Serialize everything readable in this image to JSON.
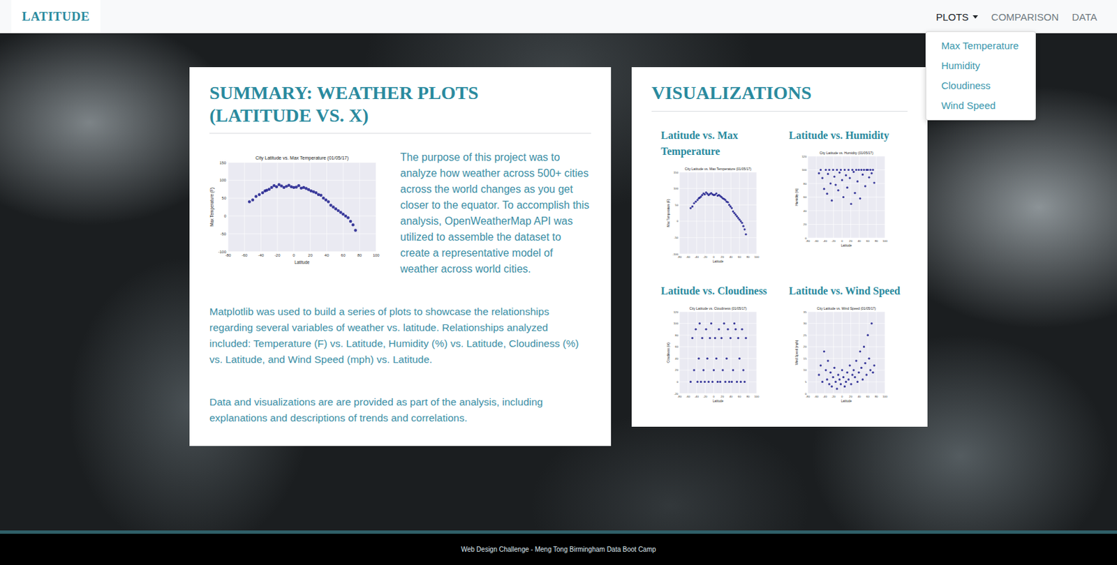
{
  "navbar": {
    "brand": "LATITUDE",
    "items": [
      {
        "label": "PLOTS",
        "selected": true,
        "caret": true
      },
      {
        "label": "COMPARISON",
        "selected": false,
        "caret": false
      },
      {
        "label": "DATA",
        "selected": false,
        "caret": false
      }
    ],
    "dropdown": {
      "open": true,
      "items": [
        "Max Temperature",
        "Humidity",
        "Cloudiness",
        "Wind Speed"
      ]
    }
  },
  "summary": {
    "title": "SUMMARY: WEATHER PLOTS (LATITUDE VS. X)",
    "paragraphs": [
      "The purpose of this project was to analyze how weather across 500+ cities across the world changes as you get closer to the equator. To accomplish this analysis, OpenWeatherMap API was utilized to assemble the dataset to create a representative model of weather across world cities.",
      "Matplotlib was used to build a series of plots to showcase the relationships regarding several variables of weather vs. latitude. Relationships analyzed included: Temperature (F) vs. Latitude, Humidity (%) vs. Latitude, Cloudiness (%) vs. Latitude, and Wind Speed (mph) vs. Latitude.",
      "Data and visualizations are are provided as part of the analysis, including explanations and descriptions of trends and correlations."
    ]
  },
  "visualizations": {
    "title": "VISUALIZATIONS",
    "latitudes": [
      -54,
      -50,
      -46,
      -42,
      -38,
      -35,
      -33,
      -30,
      -27,
      -24,
      -21,
      -18,
      -15,
      -12,
      -9,
      -6,
      -3,
      0,
      3,
      6,
      9,
      12,
      15,
      18,
      21,
      24,
      27,
      30,
      33,
      36,
      39,
      42,
      45,
      48,
      51,
      54,
      57,
      60,
      63,
      66,
      69,
      72,
      75
    ],
    "plots": [
      {
        "heading": "Latitude vs. Max Temperature",
        "title": "City Latitude vs. Max Temperature (01/05/17)",
        "x_label": "Latitude",
        "y_label": "Max Temperature (F)",
        "x_ticks": [
          "-80",
          "-60",
          "-40",
          "-20",
          "0",
          "20",
          "40",
          "60",
          "80",
          "100"
        ],
        "y_ticks": [
          "-100",
          "-50",
          "0",
          "50",
          "100",
          "150"
        ],
        "values": [
          40,
          45,
          55,
          60,
          65,
          70,
          72,
          75,
          80,
          85,
          82,
          88,
          84,
          80,
          83,
          86,
          82,
          80,
          81,
          85,
          78,
          80,
          77,
          74,
          70,
          68,
          65,
          60,
          58,
          50,
          45,
          40,
          30,
          25,
          20,
          15,
          10,
          5,
          0,
          -5,
          -15,
          -25,
          -40
        ]
      },
      {
        "heading": "Latitude vs. Humidity",
        "title": "City Latitude vs. Humidity (01/05/17)",
        "x_label": "Latitude",
        "y_label": "Humidity (%)",
        "x_ticks": [
          "-80",
          "-60",
          "-40",
          "-20",
          "0",
          "20",
          "40",
          "60",
          "80",
          "100"
        ],
        "y_ticks": [
          "0",
          "20",
          "40",
          "60",
          "80",
          "100",
          "120"
        ],
        "values": [
          95,
          100,
          88,
          72,
          100,
          65,
          94,
          100,
          80,
          55,
          100,
          90,
          78,
          100,
          70,
          96,
          100,
          85,
          60,
          100,
          92,
          74,
          100,
          88,
          50,
          100,
          97,
          66,
          100,
          83,
          100,
          58,
          100,
          93,
          100,
          76,
          100,
          100,
          89,
          100,
          95,
          100,
          81
        ]
      },
      {
        "heading": "Latitude vs. Cloudiness",
        "title": "City Latitude vs. Cloudiness (01/05/17)",
        "x_label": "Latitude",
        "y_label": "Cloudiness (%)",
        "x_ticks": [
          "-80",
          "-60",
          "-40",
          "-20",
          "0",
          "20",
          "40",
          "60",
          "80",
          "100"
        ],
        "y_ticks": [
          "-20",
          "0",
          "20",
          "40",
          "60",
          "80",
          "100",
          "120"
        ],
        "values": [
          0,
          75,
          20,
          90,
          0,
          40,
          100,
          0,
          75,
          20,
          0,
          90,
          40,
          0,
          75,
          100,
          0,
          20,
          75,
          40,
          0,
          90,
          0,
          75,
          20,
          100,
          0,
          40,
          90,
          0,
          75,
          0,
          20,
          100,
          90,
          0,
          75,
          40,
          0,
          90,
          20,
          0,
          75
        ]
      },
      {
        "heading": "Latitude vs. Wind Speed",
        "title": "City Latitude vs. Wind Speed (01/05/17)",
        "x_label": "Latitude",
        "y_label": "Wind Speed (mph)",
        "x_ticks": [
          "-80",
          "-60",
          "-40",
          "-20",
          "0",
          "20",
          "40",
          "60",
          "80",
          "100"
        ],
        "y_ticks": [
          "0",
          "5",
          "10",
          "15",
          "20",
          "25",
          "30",
          "35"
        ],
        "values": [
          8,
          12,
          5,
          18,
          10,
          6,
          14,
          4,
          9,
          3,
          7,
          11,
          5,
          2,
          8,
          6,
          4,
          10,
          7,
          3,
          5,
          9,
          6,
          12,
          4,
          8,
          10,
          7,
          14,
          5,
          9,
          18,
          11,
          6,
          20,
          13,
          8,
          25,
          15,
          10,
          30,
          9,
          12
        ]
      }
    ]
  },
  "footer": "Web Design Challenge - Meng Tong Birmingham Data Boot Camp"
}
